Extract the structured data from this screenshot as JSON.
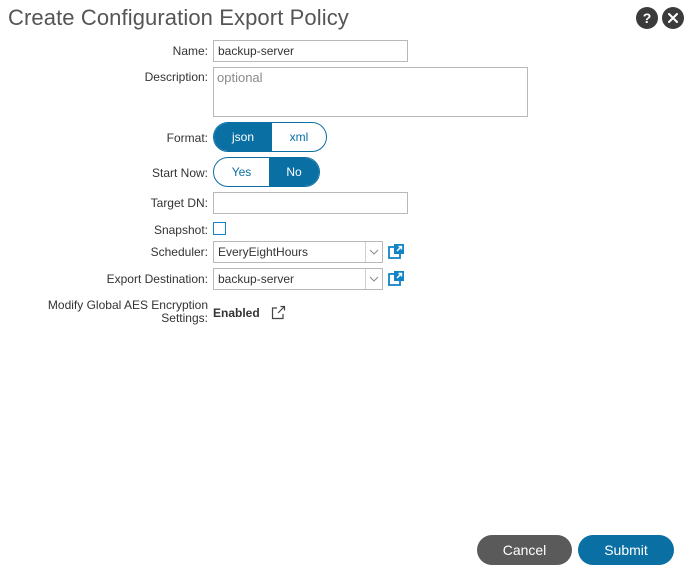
{
  "dialog": {
    "title": "Create Configuration Export Policy",
    "help_icon": "question-icon",
    "close_icon": "close-icon"
  },
  "form": {
    "name": {
      "label": "Name:",
      "value": "backup-server"
    },
    "description": {
      "label": "Description:",
      "value": "",
      "placeholder": "optional"
    },
    "format": {
      "label": "Format:",
      "options": [
        "json",
        "xml"
      ],
      "selected": "json"
    },
    "start_now": {
      "label": "Start Now:",
      "options": [
        "Yes",
        "No"
      ],
      "selected": "No"
    },
    "target_dn": {
      "label": "Target DN:",
      "value": ""
    },
    "snapshot": {
      "label": "Snapshot:",
      "checked": false
    },
    "scheduler": {
      "label": "Scheduler:",
      "value": "EveryEightHours"
    },
    "export_destination": {
      "label": "Export Destination:",
      "value": "backup-server"
    },
    "aes": {
      "label_line1": "Modify Global AES Encryption",
      "label_line2": "Settings:",
      "value": "Enabled"
    }
  },
  "footer": {
    "cancel": "Cancel",
    "submit": "Submit"
  },
  "colors": {
    "accent": "#0a6fa3",
    "cancel_bg": "#5a5a5a",
    "link_icon": "#1284c4"
  }
}
